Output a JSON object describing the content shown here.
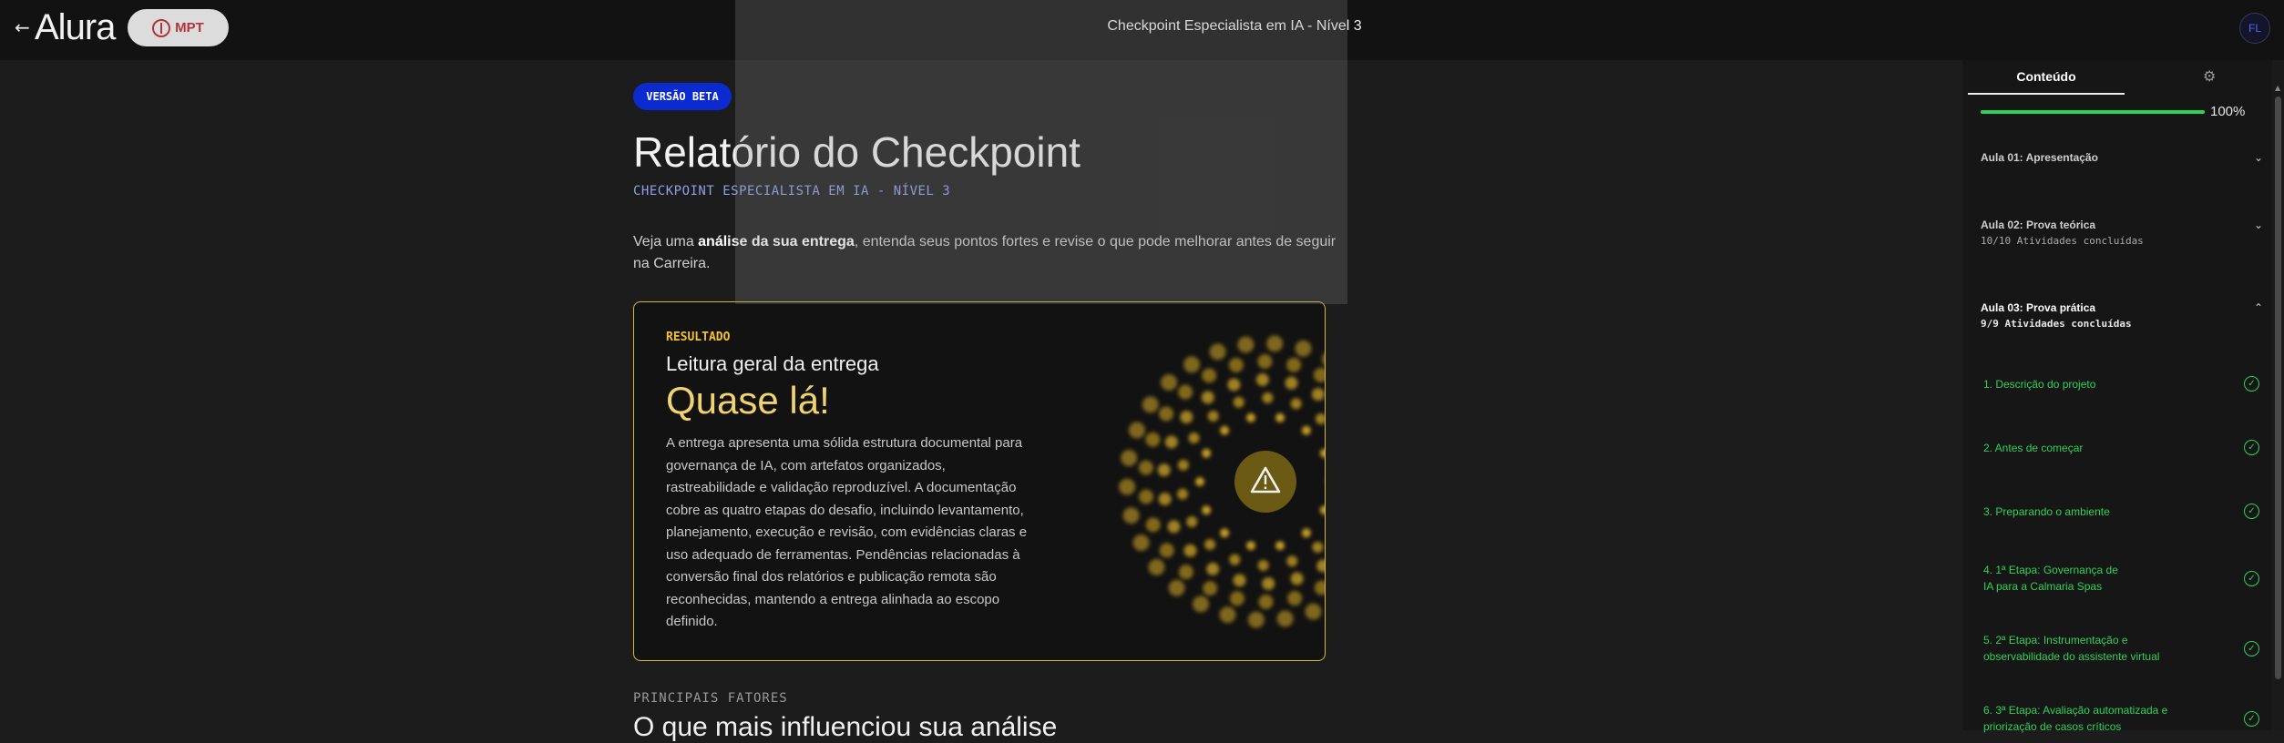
{
  "header": {
    "back_icon": "arrow-left-icon",
    "logo_text": "Alura",
    "partner_text": "MPT",
    "title": "Checkpoint Especialista em IA - Nível 3",
    "avatar_initials": "FL"
  },
  "main": {
    "badge": "VERSÃO BETA",
    "title": "Relatório do Checkpoint",
    "subtitle": "CHECKPOINT ESPECIALISTA EM IA - NÍVEL 3",
    "intro_prefix": "Veja uma ",
    "intro_bold": "análise da sua entrega",
    "intro_suffix": ", entenda seus pontos fortes e revise o que pode melhorar antes de seguir na Carreira.",
    "result": {
      "label": "RESULTADO",
      "heading": "Leitura geral da entrega",
      "status": "Quase lá!",
      "description": "A entrega apresenta uma sólida estrutura documental para governança de IA, com artefatos organizados, rastreabilidade e validação reproduzível. A documentação cobre as quatro etapas do desafio, incluindo levantamento, planejamento, execução e revisão, com evidências claras e uso adequado de ferramentas. Pendências relacionadas à conversão final dos relatórios e publicação remota são reconhecidas, mantendo a entrega alinhada ao escopo definido.",
      "icon": "warning-icon",
      "accent": "#d8b836"
    },
    "factors_kicker": "PRINCIPAIS FATORES",
    "factors_title": "O que mais influenciou sua análise"
  },
  "sidebar": {
    "tab_label": "Conteúdo",
    "settings_icon": "gear-icon",
    "progress_text": "100%",
    "progress_value": 1.0,
    "lessons": [
      {
        "title": "Aula 01: Apresentação",
        "sub": "",
        "expanded": false
      },
      {
        "title": "Aula 02: Prova teórica",
        "sub": "10/10 Atividades concluídas",
        "expanded": false
      },
      {
        "title": "Aula 03: Prova prática",
        "sub": "9/9 Atividades concluídas",
        "expanded": true
      }
    ],
    "activities": [
      "1. Descrição do projeto",
      "2. Antes de começar",
      "3. Preparando o ambiente",
      "4. 1ª Etapa: Governança de IA para a Calmaria Spas",
      "5. 2ª Etapa: Instrumentação e observabilidade do assistente virtual",
      "6. 3ª Etapa: Avaliação automatizada e priorização de casos críticos"
    ],
    "accent": "#2fd15a"
  }
}
